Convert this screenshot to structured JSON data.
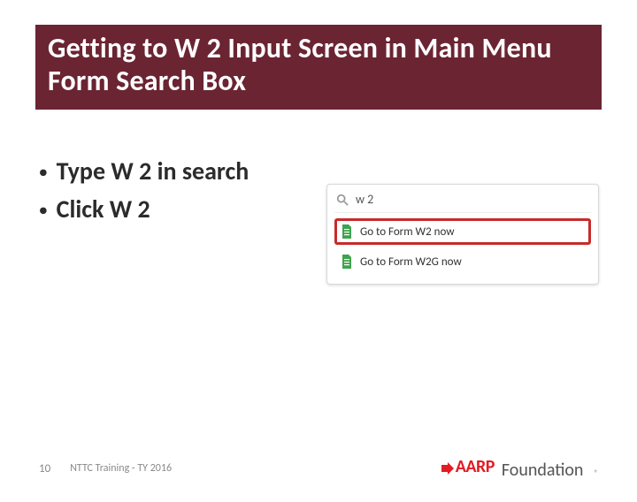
{
  "title": "Getting to W 2 Input Screen in Main Menu Form Search Box",
  "bullets": [
    "Type W 2 in search",
    "Click W 2"
  ],
  "search": {
    "value": "w 2",
    "options": [
      {
        "label": "Go to Form W2 now",
        "highlight": true
      },
      {
        "label": "Go to Form W2G now",
        "highlight": false
      }
    ]
  },
  "footer": {
    "page": "10",
    "text": "NTTC Training - TY 2016"
  },
  "logo": {
    "brand": "AARP",
    "sub": "Foundation",
    "reg": "®"
  }
}
